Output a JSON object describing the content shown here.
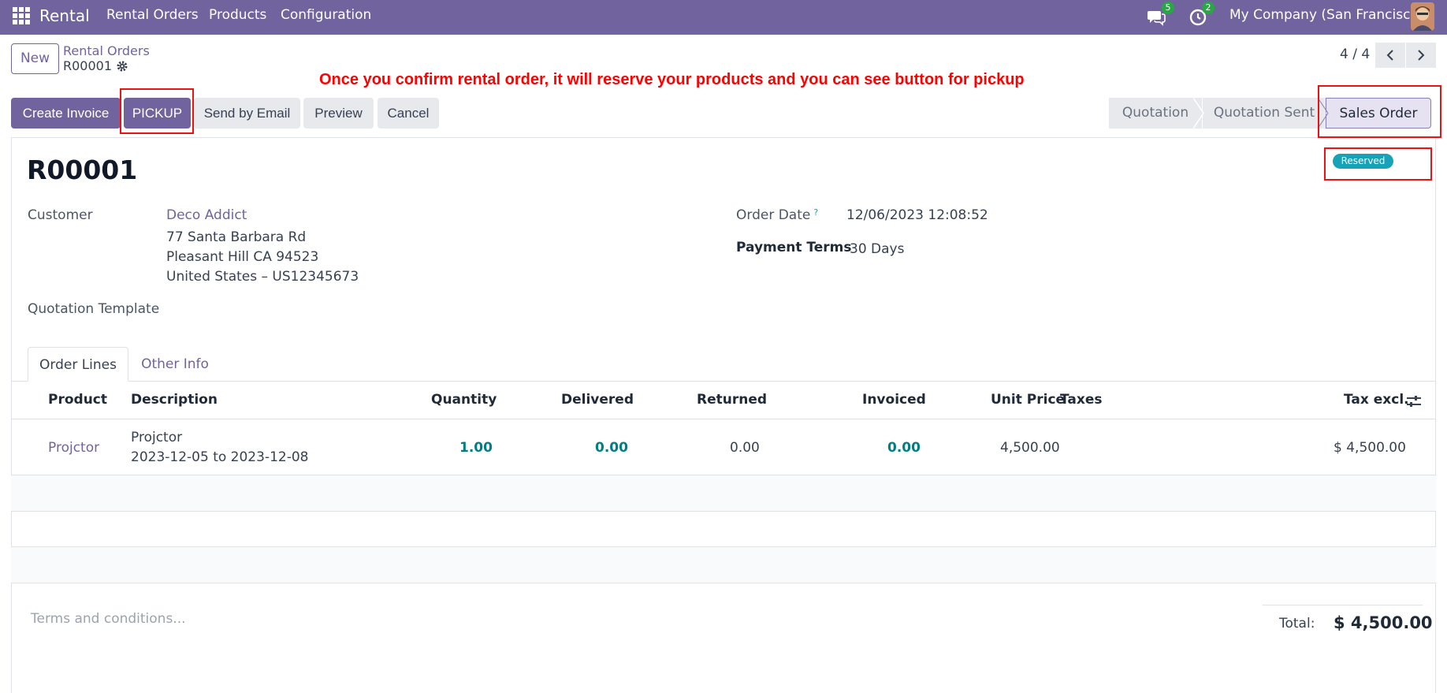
{
  "navbar": {
    "brand": "Rental",
    "menu": [
      "Rental Orders",
      "Products",
      "Configuration"
    ],
    "messages_count": "5",
    "activities_count": "2",
    "company": "My Company (San Francisco)"
  },
  "control_panel": {
    "new_label": "New",
    "breadcrumb_parent": "Rental Orders",
    "breadcrumb_current": "R00001",
    "pager": "4 / 4"
  },
  "annotation": "Once you confirm rental order, it will reserve your products and you can see button for pickup",
  "actions": {
    "create_invoice": "Create Invoice",
    "pickup": "PICKUP",
    "send_by_email": "Send by Email",
    "preview": "Preview",
    "cancel": "Cancel"
  },
  "statusbar": {
    "steps": [
      "Quotation",
      "Quotation Sent",
      "Sales Order"
    ],
    "active": "Sales Order"
  },
  "record": {
    "name": "R00001",
    "status_badge": "Reserved",
    "customer_label": "Customer",
    "customer_name": "Deco Addict",
    "address_line1": "77 Santa Barbara Rd",
    "address_line2": "Pleasant Hill CA 94523",
    "address_line3": "United States – US12345673",
    "quotation_template_label": "Quotation Template",
    "order_date_label": "Order Date",
    "order_date_help": "?",
    "order_date": "12/06/2023 12:08:52",
    "payment_terms_label": "Payment Terms",
    "payment_terms": "30 Days"
  },
  "tabs": [
    "Order Lines",
    "Other Info"
  ],
  "order_lines": {
    "columns": [
      "Product",
      "Description",
      "Quantity",
      "Delivered",
      "Returned",
      "Invoiced",
      "Unit Price",
      "Taxes",
      "Tax excl."
    ],
    "rows": [
      {
        "product": "Projctor",
        "description_line1": "Projctor",
        "description_line2": "2023-12-05 to 2023-12-08",
        "quantity": "1.00",
        "delivered": "0.00",
        "returned": "0.00",
        "invoiced": "0.00",
        "unit_price": "4,500.00",
        "taxes": "",
        "tax_excl": "$ 4,500.00"
      }
    ]
  },
  "footer": {
    "terms_placeholder": "Terms and conditions...",
    "total_label": "Total:",
    "total_value": "$ 4,500.00"
  },
  "colors": {
    "brand": "#71639e",
    "annotation": "#ff0000",
    "reserved": "#17a2b8"
  }
}
